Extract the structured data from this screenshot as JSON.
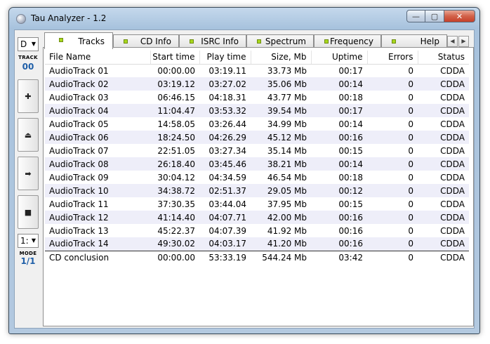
{
  "window": {
    "title": "Tau Analyzer - 1.2",
    "buttons": {
      "minimize": "—",
      "maximize": "▢",
      "close": "✕"
    }
  },
  "sidebar": {
    "drive": "D",
    "track_label": "TRACK",
    "track_value": "00",
    "buttons": [
      {
        "name": "add",
        "glyph": "✚"
      },
      {
        "name": "eject",
        "glyph": "⏏"
      },
      {
        "name": "next",
        "glyph": "➡"
      },
      {
        "name": "stop",
        "glyph": "■"
      }
    ],
    "mode_select": "1:",
    "mode_label": "MODE",
    "mode_value": "1/1"
  },
  "tabs": [
    {
      "label": "Tracks",
      "active": true
    },
    {
      "label": "CD Info",
      "active": false
    },
    {
      "label": "ISRC Info",
      "active": false
    },
    {
      "label": "Spectrum",
      "active": false
    },
    {
      "label": "Frequency",
      "active": false
    },
    {
      "label": "Help",
      "active": false
    }
  ],
  "table": {
    "columns": [
      "File Name",
      "Start time",
      "Play time",
      "Size, Mb",
      "Uptime",
      "Errors",
      "Status"
    ],
    "rows": [
      [
        "AudioTrack 01",
        "00:00.00",
        "03:19.11",
        "33.73 Mb",
        "00:17",
        "0",
        "CDDA"
      ],
      [
        "AudioTrack 02",
        "03:19.12",
        "03:27.02",
        "35.06 Mb",
        "00:14",
        "0",
        "CDDA"
      ],
      [
        "AudioTrack 03",
        "06:46.15",
        "04:18.31",
        "43.77 Mb",
        "00:18",
        "0",
        "CDDA"
      ],
      [
        "AudioTrack 04",
        "11:04.47",
        "03:53.32",
        "39.54 Mb",
        "00:17",
        "0",
        "CDDA"
      ],
      [
        "AudioTrack 05",
        "14:58.05",
        "03:26.44",
        "34.99 Mb",
        "00:14",
        "0",
        "CDDA"
      ],
      [
        "AudioTrack 06",
        "18:24.50",
        "04:26.29",
        "45.12 Mb",
        "00:16",
        "0",
        "CDDA"
      ],
      [
        "AudioTrack 07",
        "22:51.05",
        "03:27.34",
        "35.14 Mb",
        "00:15",
        "0",
        "CDDA"
      ],
      [
        "AudioTrack 08",
        "26:18.40",
        "03:45.46",
        "38.21 Mb",
        "00:14",
        "0",
        "CDDA"
      ],
      [
        "AudioTrack 09",
        "30:04.12",
        "04:34.59",
        "46.54 Mb",
        "00:18",
        "0",
        "CDDA"
      ],
      [
        "AudioTrack 10",
        "34:38.72",
        "02:51.37",
        "29.05 Mb",
        "00:12",
        "0",
        "CDDA"
      ],
      [
        "AudioTrack 11",
        "37:30.35",
        "03:44.04",
        "37.95 Mb",
        "00:15",
        "0",
        "CDDA"
      ],
      [
        "AudioTrack 12",
        "41:14.40",
        "04:07.71",
        "42.00 Mb",
        "00:16",
        "0",
        "CDDA"
      ],
      [
        "AudioTrack 13",
        "45:22.37",
        "04:07.39",
        "41.92 Mb",
        "00:16",
        "0",
        "CDDA"
      ],
      [
        "AudioTrack 14",
        "49:30.02",
        "04:03.17",
        "41.20 Mb",
        "00:16",
        "0",
        "CDDA"
      ]
    ],
    "summary": [
      "CD conclusion",
      "00:00.00",
      "53:33.19",
      "544.24 Mb",
      "03:42",
      "0",
      "CDDA"
    ]
  }
}
